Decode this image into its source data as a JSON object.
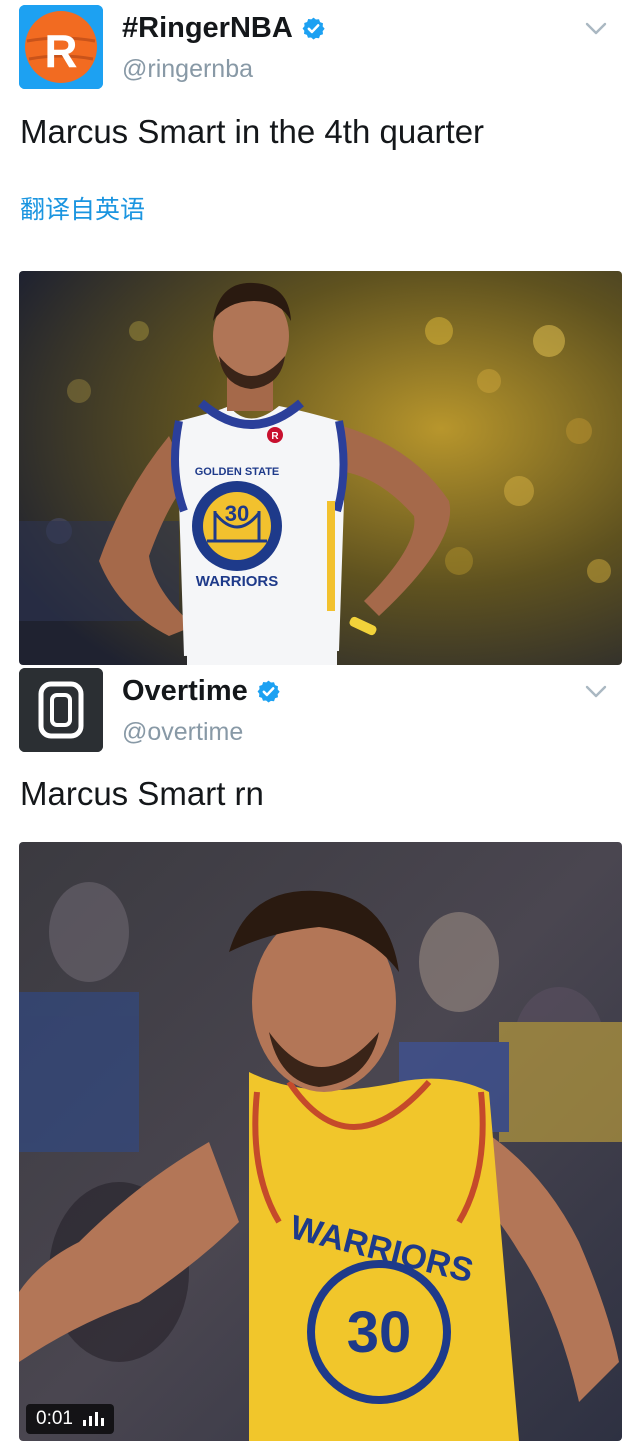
{
  "tweets": [
    {
      "display_name": "#RingerNBA",
      "handle": "@ringernba",
      "text": "Marcus Smart in the 4th quarter",
      "translate_label": "翻译自英语",
      "avatar_letter": "R",
      "media": {
        "jersey_text_top": "GOLDEN STATE",
        "jersey_number": "30",
        "jersey_text_bottom": "WARRIORS",
        "sponsor_letter": "R"
      }
    },
    {
      "display_name": "Overtime",
      "handle": "@overtime",
      "text": "Marcus Smart rn",
      "avatar_letter": "0",
      "media": {
        "jersey_text": "WARRIORS",
        "jersey_number": "30",
        "video_time": "0:01"
      }
    }
  ],
  "icons": {
    "verified": "verified-badge-icon",
    "menu": "chevron-down-icon",
    "volume": "volume-bars-icon"
  },
  "colors": {
    "verified_blue": "#1da1f2",
    "link_blue": "#1b95e0",
    "handle_gray": "#8899a6",
    "ringer_orange": "#f26b21",
    "overtime_dark": "#2b2f33"
  }
}
